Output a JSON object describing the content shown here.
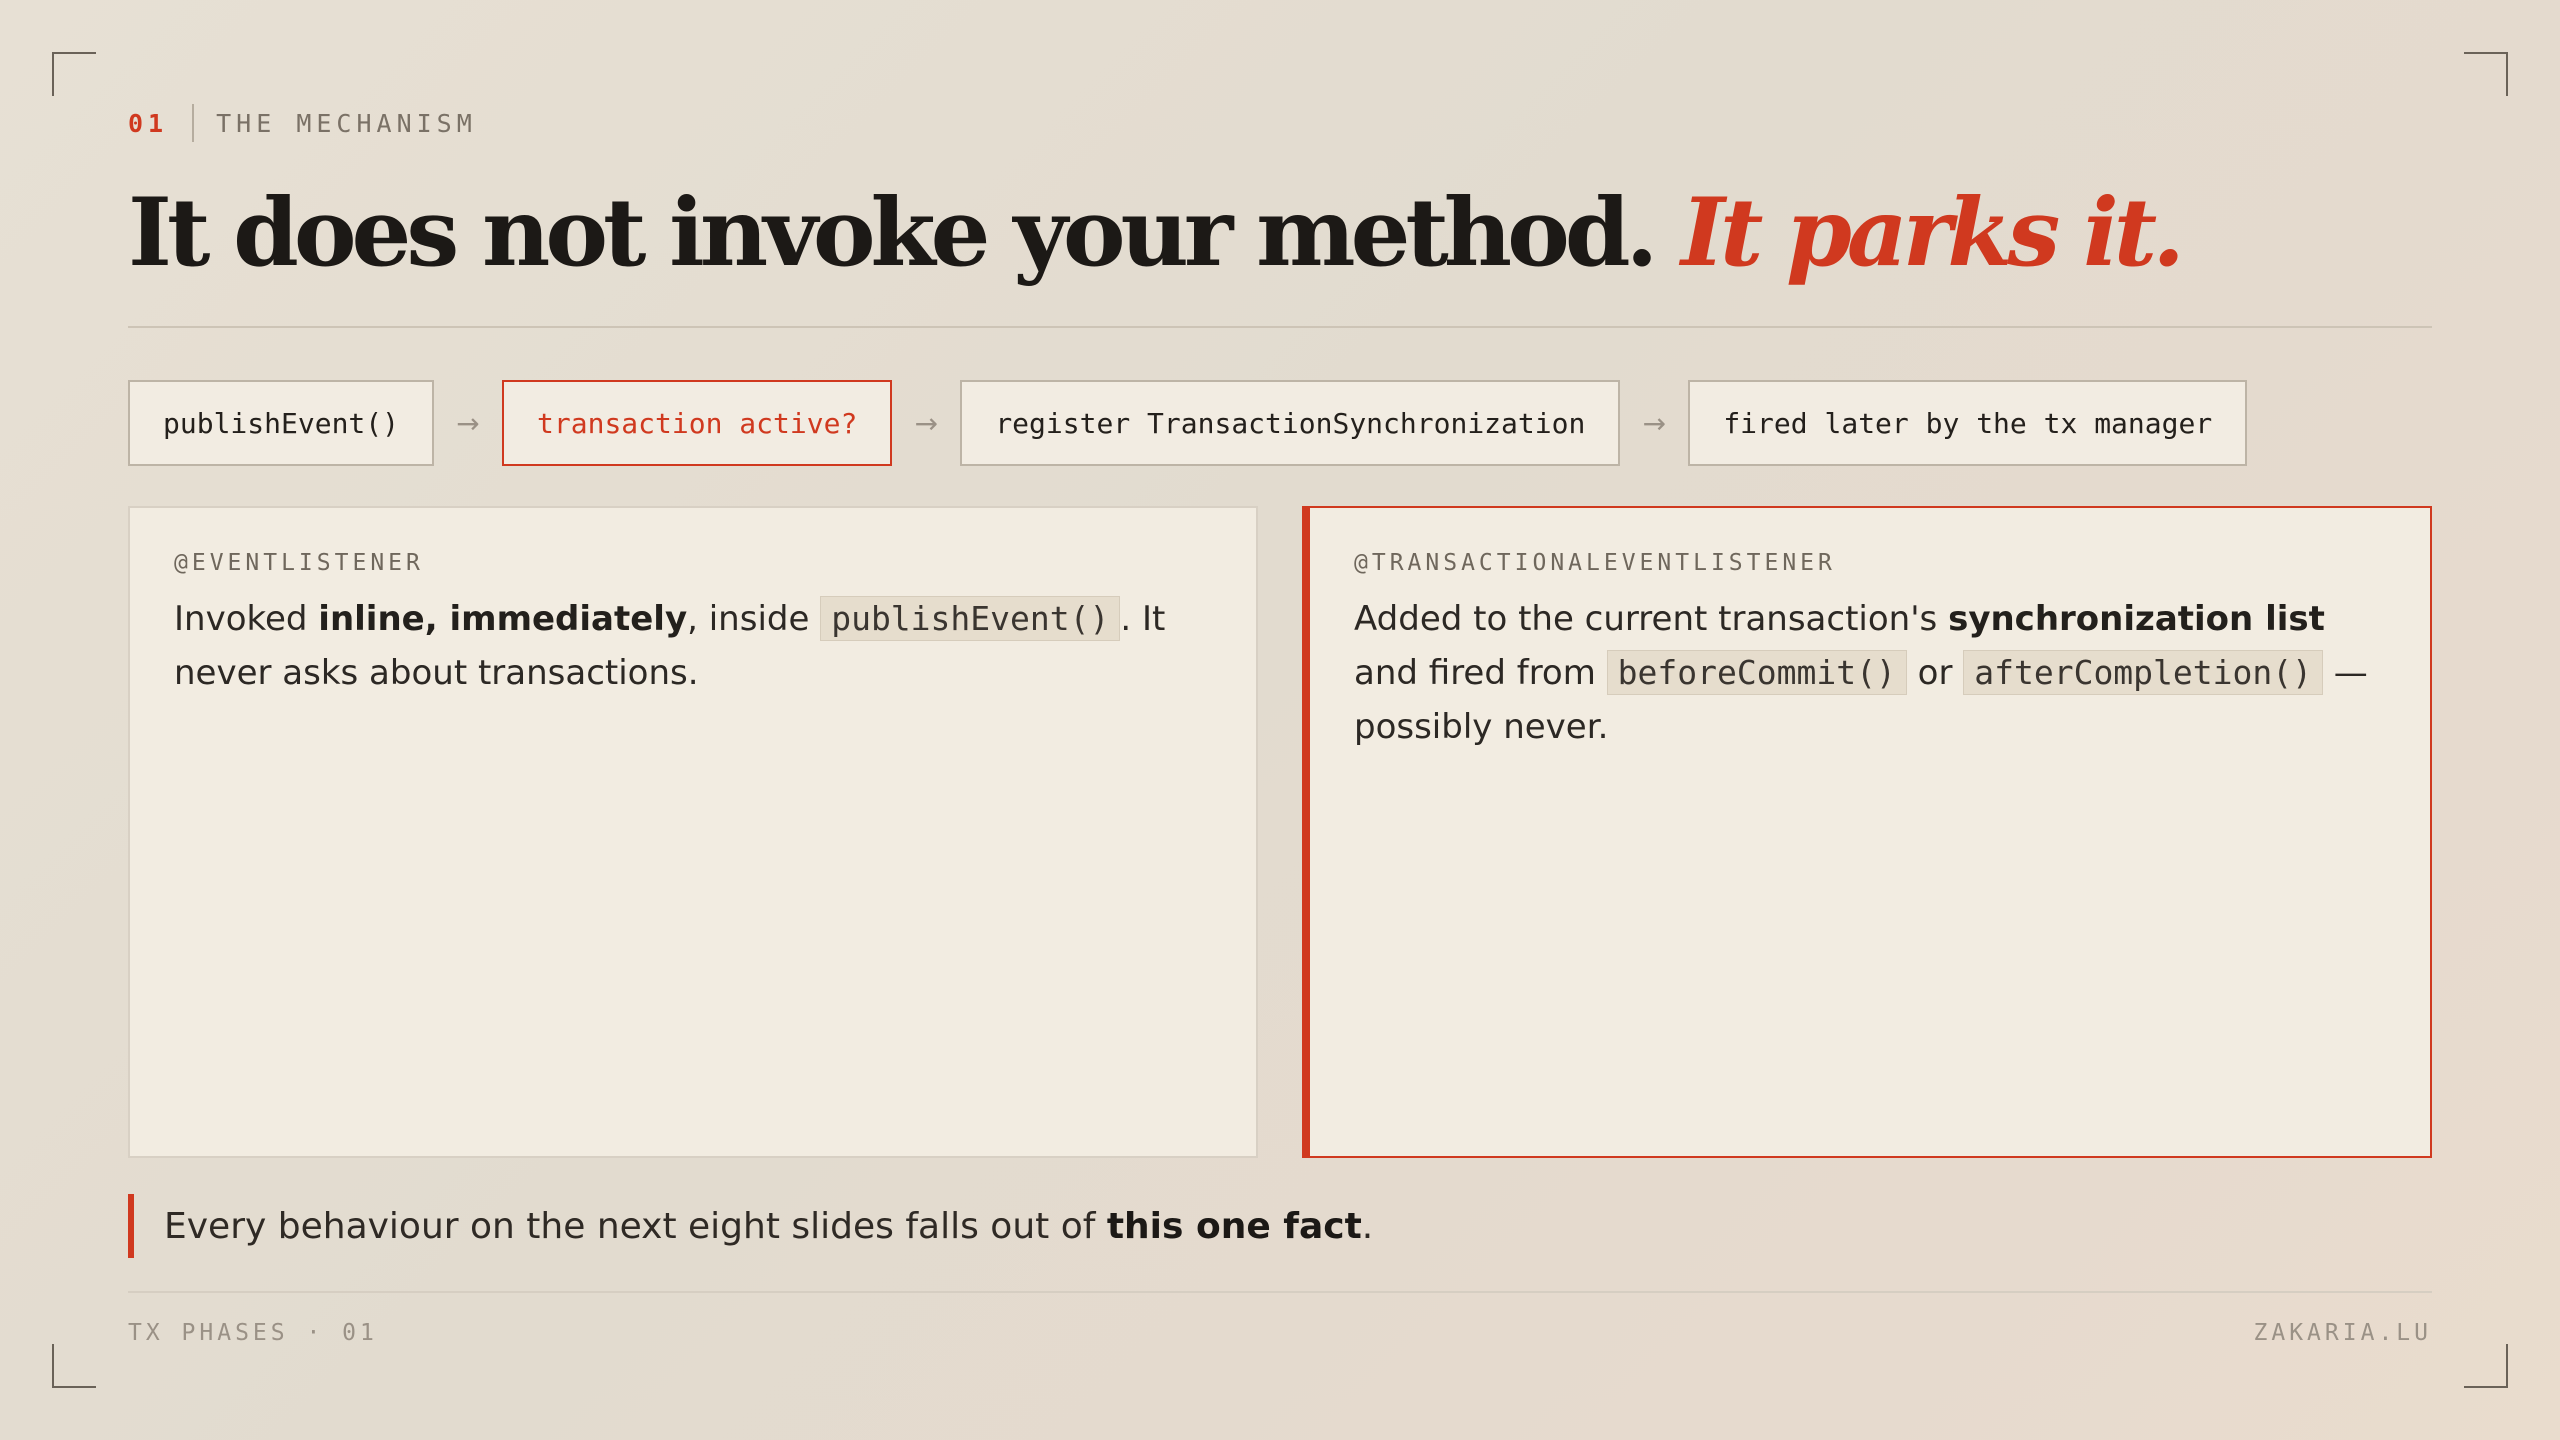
{
  "eyebrow": {
    "number": "01",
    "label": "THE MECHANISM"
  },
  "headline": {
    "main": "It does not invoke your method.",
    "accent": "It parks it."
  },
  "flow": {
    "steps": [
      "publishEvent()",
      "transaction active?",
      "register TransactionSynchronization",
      "fired later by the tx manager"
    ],
    "arrow": "→"
  },
  "cards": {
    "left": {
      "tag": "@EVENTLISTENER",
      "t1": "Invoked ",
      "b1": "inline, immediately",
      "t2": ", inside ",
      "code1": "publishEvent()",
      "t3": ". It never asks about transactions."
    },
    "right": {
      "tag": "@TRANSACTIONALEVENTLISTENER",
      "t1": "Added to the current transaction's ",
      "b1": "synchronization list",
      "t2": " and fired from ",
      "code1": "beforeCommit()",
      "t3": " or ",
      "code2": "afterCompletion()",
      "t4": " — possibly never."
    }
  },
  "callout": {
    "text": "Every behaviour on the next eight slides falls out of ",
    "bold": "this one fact",
    "end": "."
  },
  "footer": {
    "left": "TX PHASES · 01",
    "right": "ZAKARIA.LU"
  },
  "colors": {
    "accent": "#d0391f",
    "background": "#e4ddd1",
    "ink": "#1c1916"
  }
}
